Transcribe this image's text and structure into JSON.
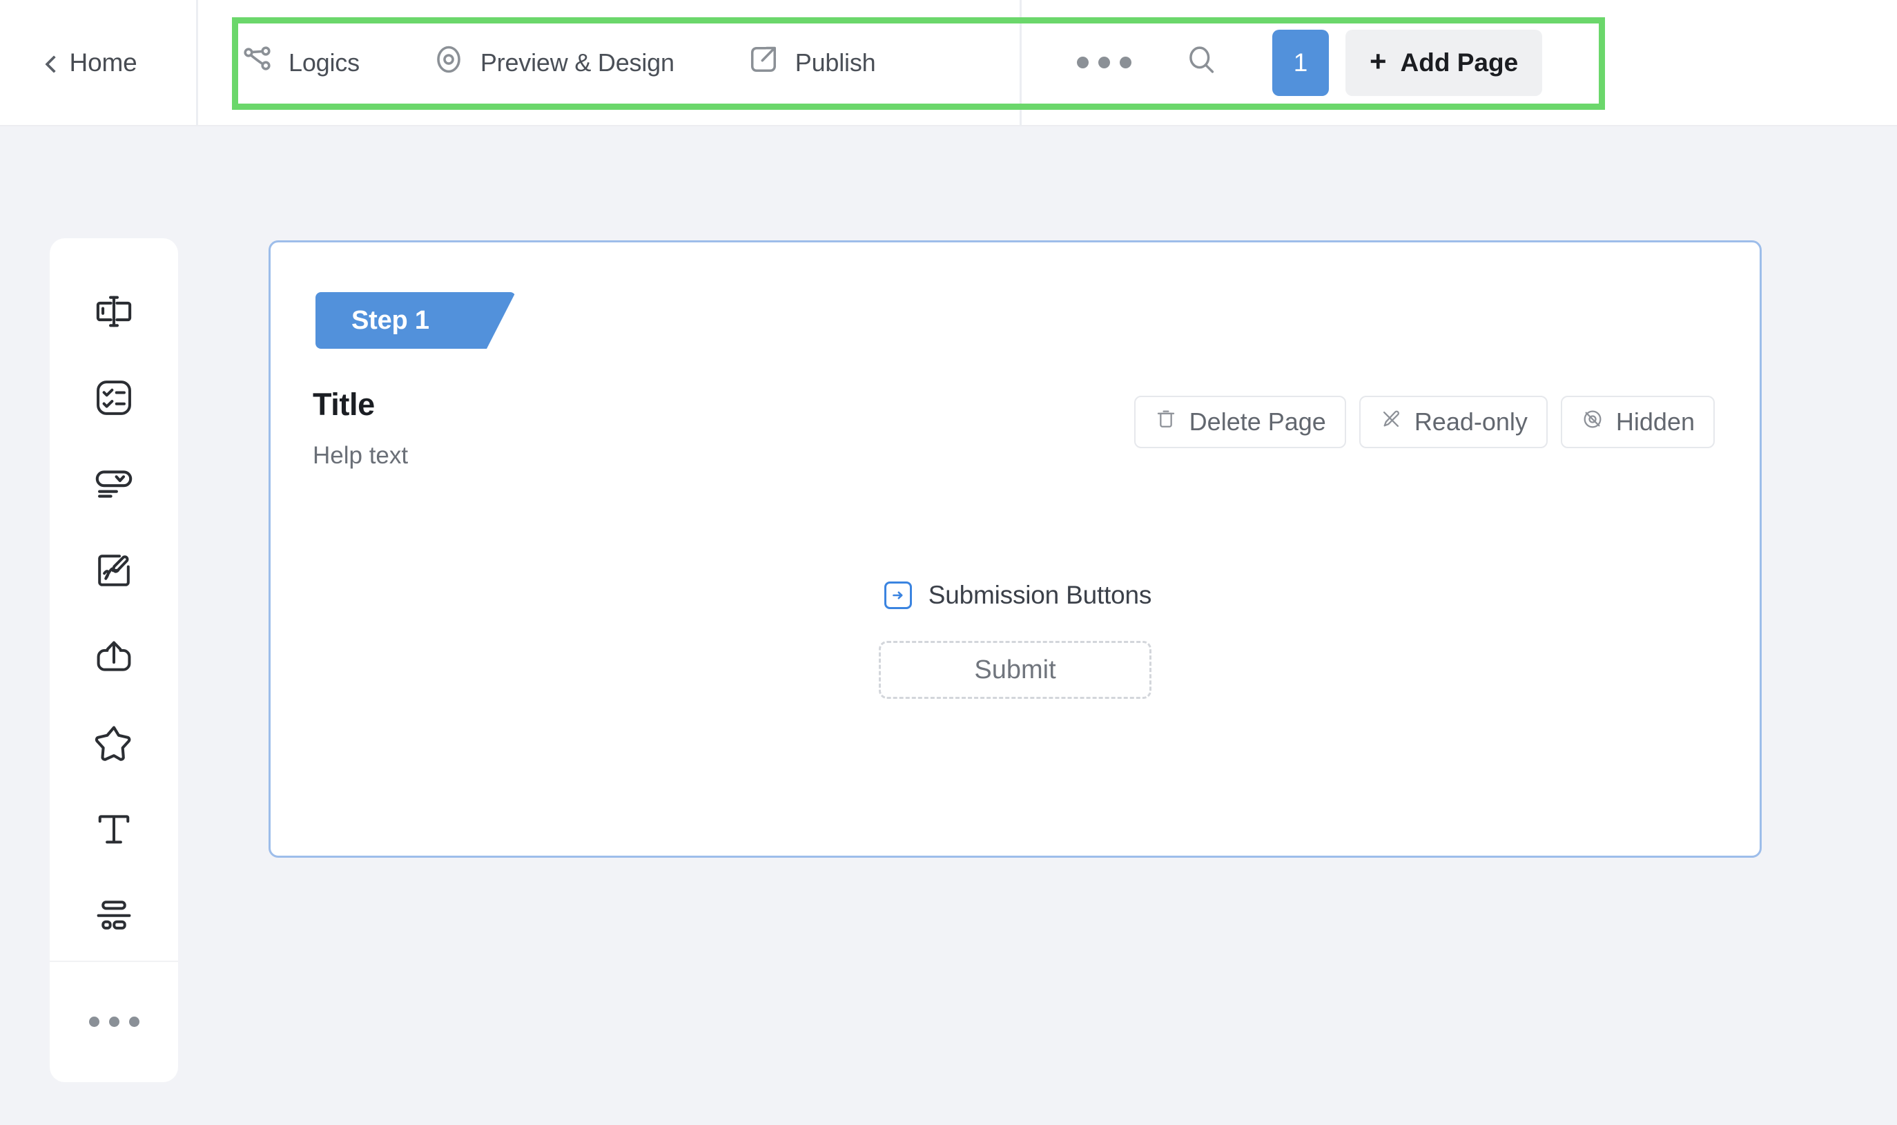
{
  "header": {
    "home": {
      "label": "Home",
      "icon": "chevron-left-icon"
    },
    "nav_items": [
      {
        "label": "Logics",
        "icon": "share-nodes-icon"
      },
      {
        "label": "Preview & Design",
        "icon": "eye-target-icon"
      },
      {
        "label": "Publish",
        "icon": "external-link-icon"
      }
    ],
    "more_icon": "ellipsis-icon",
    "search_icon": "search-icon",
    "page_number": "1",
    "add_page": {
      "label": "Add Page",
      "plus": "+"
    }
  },
  "highlight": {
    "color": "#6bd76b"
  },
  "sidebar": {
    "items": [
      {
        "icon": "text-input-icon",
        "name": "short-text-field"
      },
      {
        "icon": "checklist-icon",
        "name": "multiple-choice-field"
      },
      {
        "icon": "dropdown-icon",
        "name": "dropdown-field"
      },
      {
        "icon": "signature-icon",
        "name": "signature-field"
      },
      {
        "icon": "upload-icon",
        "name": "file-upload-field"
      },
      {
        "icon": "star-icon",
        "name": "rating-field"
      },
      {
        "icon": "text-block-icon",
        "name": "text-block"
      },
      {
        "icon": "layout-section-icon",
        "name": "section-layout"
      }
    ],
    "more_icon": "ellipsis-icon"
  },
  "card": {
    "step_badge": "Step 1",
    "title": "Title",
    "help_text": "Help text",
    "actions": [
      {
        "label": "Delete Page",
        "icon": "trash-icon"
      },
      {
        "label": "Read-only",
        "icon": "pen-slash-icon"
      },
      {
        "label": "Hidden",
        "icon": "eye-slash-icon"
      }
    ],
    "submission": {
      "label": "Submission Buttons",
      "icon": "arrow-right-box-icon",
      "submit_label": "Submit"
    }
  },
  "colors": {
    "accent_blue": "#5291db",
    "card_border": "#9dbdea",
    "highlight_green": "#6bd76b",
    "page_bg": "#f2f3f7"
  }
}
